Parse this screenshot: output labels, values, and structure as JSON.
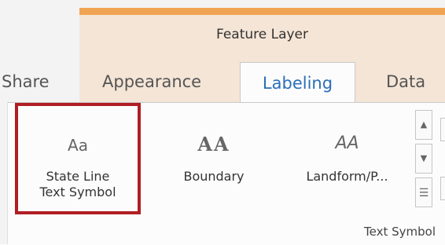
{
  "contextual_tab_group": {
    "title": "Feature Layer",
    "accent_color": "#f0a452",
    "background_color": "#f5e5d6"
  },
  "tabs": [
    {
      "label": "Share",
      "active": false
    },
    {
      "label": "Appearance",
      "active": false
    },
    {
      "label": "Labeling",
      "active": true
    },
    {
      "label": "Data",
      "active": false
    }
  ],
  "gallery": {
    "group_label": "Text Symbol",
    "selection_color": "#b01e24",
    "items": [
      {
        "sample": "Aa",
        "label_line1": "State Line",
        "label_line2": "Text Symbol",
        "selected": true
      },
      {
        "sample": "AA",
        "label_line1": "Boundary",
        "label_line2": "",
        "selected": false
      },
      {
        "sample": "AA",
        "label_line1": "Landform/P...",
        "label_line2": "",
        "selected": false
      }
    ],
    "scroll": {
      "up_icon": "triangle-up",
      "down_icon": "triangle-down",
      "more_icon": "expand-gallery"
    }
  }
}
